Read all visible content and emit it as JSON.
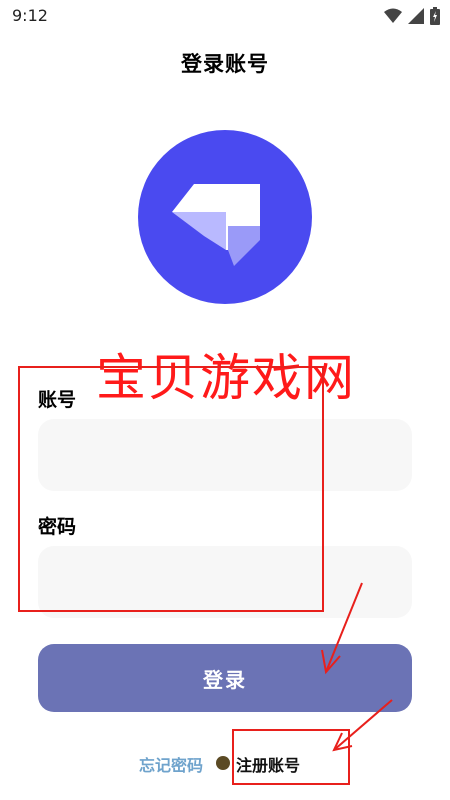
{
  "status_bar": {
    "time": "9:12"
  },
  "header": {
    "title": "登录账号"
  },
  "watermark": "宝贝游戏网",
  "form": {
    "account_label": "账号",
    "account_value": "",
    "password_label": "密码",
    "password_value": "",
    "submit_label": "登录"
  },
  "footer": {
    "forgot_label": "忘记密码",
    "register_label": "注册账号"
  },
  "colors": {
    "logo_bg": "#4a4af0",
    "button_bg": "#6b73b5",
    "forgot_link": "#6fa3cc",
    "annotation": "#e8201c"
  },
  "icons": [
    "wifi-icon",
    "signal-icon",
    "battery-icon",
    "app-logo-icon"
  ]
}
